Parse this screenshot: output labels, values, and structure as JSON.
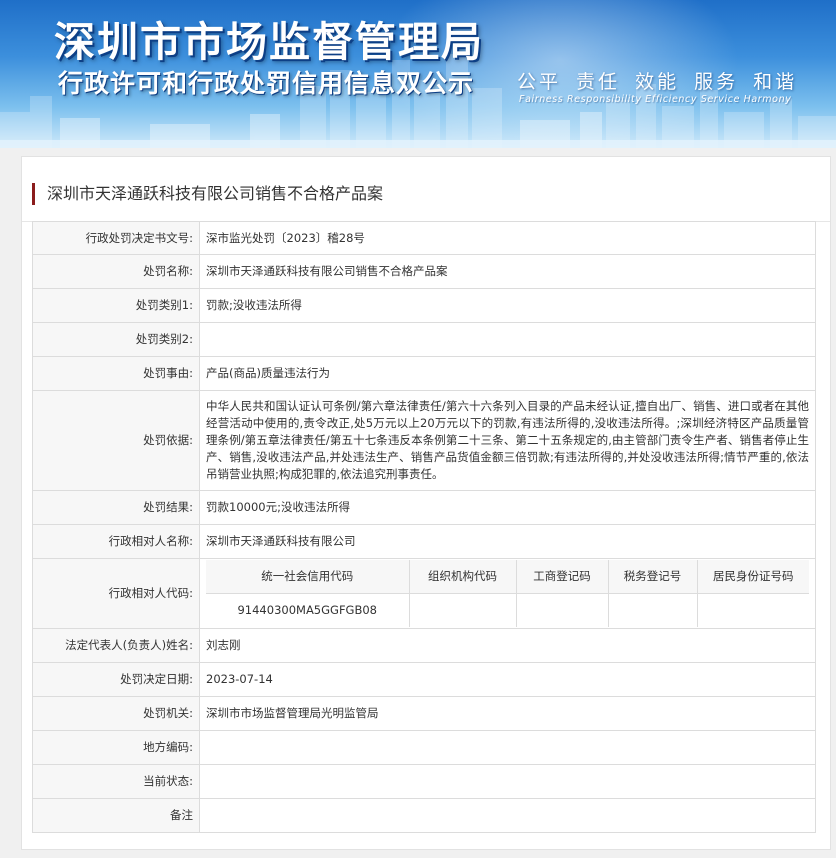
{
  "banner": {
    "title": "深圳市市场监督管理局",
    "subtitle": "行政许可和行政处罚信用信息双公示",
    "slogan": "公平 责任 效能 服务 和谐",
    "slogan_en": "Fairness Responsibility Efficiency Service Harmony"
  },
  "page": {
    "title": "深圳市天泽通跃科技有限公司销售不合格产品案"
  },
  "rows": {
    "decision_no": {
      "label": "行政处罚决定书文号:",
      "value": "深市监光处罚〔2023〕稽28号"
    },
    "penalty_name": {
      "label": "处罚名称:",
      "value": "深圳市天泽通跃科技有限公司销售不合格产品案"
    },
    "category1": {
      "label": "处罚类别1:",
      "value": "罚款;没收违法所得"
    },
    "category2": {
      "label": "处罚类别2:",
      "value": ""
    },
    "reason": {
      "label": "处罚事由:",
      "value": "产品(商品)质量违法行为"
    },
    "basis": {
      "label": "处罚依据:",
      "value": "中华人民共和国认证认可条例/第六章法律责任/第六十六条列入目录的产品未经认证,擅自出厂、销售、进口或者在其他经营活动中使用的,责令改正,处5万元以上20万元以下的罚款,有违法所得的,没收违法所得。;深圳经济特区产品质量管理条例/第五章法律责任/第五十七条违反本条例第二十三条、第二十五条规定的,由主管部门责令生产者、销售者停止生产、销售,没收违法产品,并处违法生产、销售产品货值金额三倍罚款;有违法所得的,并处没收违法所得;情节严重的,依法吊销营业执照;构成犯罪的,依法追究刑事责任。"
    },
    "result": {
      "label": "处罚结果:",
      "value": "罚款10000元;没收违法所得"
    },
    "party_name": {
      "label": "行政相对人名称:",
      "value": "深圳市天泽通跃科技有限公司"
    },
    "party_code": {
      "label": "行政相对人代码:",
      "headers": [
        "统一社会信用代码",
        "组织机构代码",
        "工商登记码",
        "税务登记号",
        "居民身份证号码"
      ],
      "values": [
        "91440300MA5GGFGB08",
        "",
        "",
        "",
        ""
      ]
    },
    "legal_rep": {
      "label": "法定代表人(负责人)姓名:",
      "value": "刘志刚"
    },
    "decision_date": {
      "label": "处罚决定日期:",
      "value": "2023-07-14"
    },
    "authority": {
      "label": "处罚机关:",
      "value": "深圳市市场监督管理局光明监管局"
    },
    "local_code": {
      "label": "地方编码:",
      "value": ""
    },
    "status": {
      "label": "当前状态:",
      "value": ""
    },
    "remark": {
      "label": "备注",
      "value": ""
    }
  }
}
